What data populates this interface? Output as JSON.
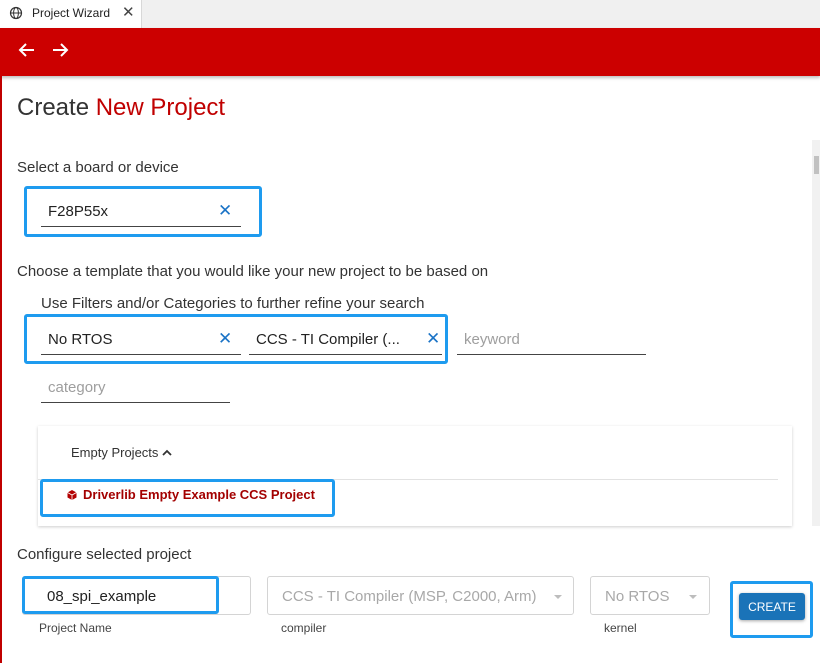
{
  "tab": {
    "title": "Project Wizard",
    "icon": "globe-icon"
  },
  "colors": {
    "brand": "#cc0000",
    "highlight": "#1e9bef",
    "create_button": "#1a73b8"
  },
  "title": {
    "prefix": "Create",
    "accent": "New Project"
  },
  "board": {
    "label": "Select a board or device",
    "value": "F28P55x"
  },
  "template": {
    "label": "Choose a template that you would like your new project to be based on",
    "filter_hint": "Use Filters and/or Categories to further refine your search",
    "filters": {
      "rtos": "No RTOS",
      "compiler": "CCS - TI Compiler (...",
      "keyword_placeholder": "keyword",
      "category_placeholder": "category"
    }
  },
  "results": {
    "group": "Empty Projects",
    "group_expanded": true,
    "item": "Driverlib Empty Example CCS Project"
  },
  "configure": {
    "label": "Configure selected project",
    "project_name": {
      "value": "08_spi_example",
      "caption": "Project Name"
    },
    "compiler": {
      "value": "CCS - TI Compiler (MSP, C2000, Arm)",
      "caption": "compiler"
    },
    "kernel": {
      "value": "No RTOS",
      "caption": "kernel"
    },
    "create_label": "CREATE"
  }
}
